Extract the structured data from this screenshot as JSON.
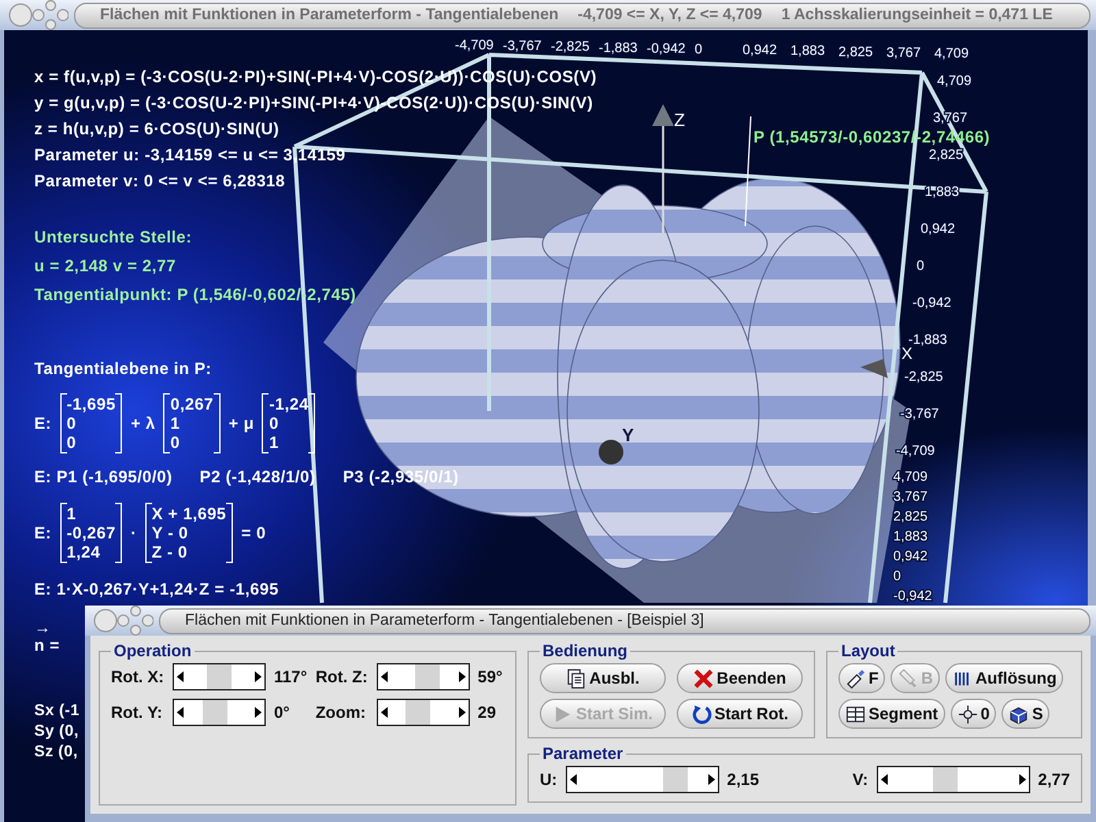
{
  "window": {
    "title": "Flächen mit Funktionen in Parameterform - Tangentialebenen",
    "range": "-4,709 <= X, Y, Z <= 4,709",
    "scale": "1 Achsskalierungseinheit = 0,471 LE"
  },
  "formulas": [
    "x = f(u,v,p) = (-3·COS(U-2·PI)+SIN(-PI+4·V)-COS(2·U))·COS(U)·COS(V)",
    "y = g(u,v,p) = (-3·COS(U-2·PI)+SIN(-PI+4·V)-COS(2·U))·COS(U)·SIN(V)",
    "z = h(u,v,p) = 6·COS(U)·SIN(U)",
    "Parameter u: -3,14159 <= u <= 3,14159",
    "Parameter v: 0 <= v <= 6,28318"
  ],
  "point": {
    "heading": "Untersuchte Stelle:",
    "uv": "u = 2,148 v = 2,77",
    "tangent_point": "Tangentialpunkt: P (1,546/-0,602/-2,745)"
  },
  "plane": {
    "heading": "Tangentialebene in P:",
    "label": "E:",
    "vectors": [
      [
        "-1,695",
        "0",
        "0"
      ],
      [
        "0,267",
        "1",
        "0"
      ],
      [
        "-1,24",
        "0",
        "1"
      ]
    ],
    "operators": [
      "+ λ",
      "+ μ"
    ],
    "points": [
      "E: P1 (-1,695/0/0)",
      "P2 (-1,428/1/0)",
      "P3 (-2,935/0/1)"
    ],
    "normal_form": {
      "label": "E:",
      "normal": [
        "1",
        "-0,267",
        "1,24"
      ],
      "dot": "·",
      "position": [
        "X + 1,695",
        "Y - 0",
        "Z - 0"
      ],
      "rhs": "= 0"
    },
    "coordinate_form": "E: 1·X-0,267·Y+1,24·Z = -1,695"
  },
  "normal_vector": {
    "arrow": "→",
    "label": "n ="
  },
  "intercepts": [
    "Sx (-1",
    "Sy (0,",
    "Sz (0,"
  ],
  "plot": {
    "x_ticks": [
      "-4,709",
      "-3,767",
      "-2,825",
      "-1,883",
      "-0,942",
      "0",
      "0,942",
      "1,883",
      "2,825",
      "3,767",
      "4,709"
    ],
    "z_ticks": [
      "4,709",
      "3,767",
      "2,825",
      "1,883",
      "0,942",
      "0",
      "-0,942",
      "-1,883",
      "-2,825",
      "-3,767",
      "-4,709"
    ],
    "y_ticks": [
      "4,709",
      "3,767",
      "2,825",
      "1,883",
      "0,942",
      "0",
      "-0,942"
    ],
    "z_label": "Z",
    "x_label": "X",
    "y_label": "Y",
    "point_label": "P (1,54573/-0,60237/-2,74466)"
  },
  "dialog": {
    "title": "Flächen mit Funktionen in Parameterform - Tangentialebenen - [Beispiel 3]",
    "operation": {
      "title": "Operation",
      "sliders": [
        {
          "label": "Rot. X:",
          "level": 0.5,
          "value": "117°"
        },
        {
          "label": "Rot. Z:",
          "level": 0.55,
          "value": "59°"
        },
        {
          "label": "Rot. Y:",
          "level": 0.45,
          "value": "0°"
        },
        {
          "label": "Zoom:",
          "level": 0.45,
          "value": "29"
        }
      ]
    },
    "control": {
      "title": "Bedienung",
      "buttons": [
        {
          "label": "Ausbl.",
          "kind": "document",
          "disabled": false
        },
        {
          "label": "Beenden",
          "kind": "cross",
          "disabled": false
        },
        {
          "label": "Start Sim.",
          "kind": "play",
          "disabled": true
        },
        {
          "label": "Start Rot.",
          "kind": "rotate",
          "disabled": false
        }
      ]
    },
    "layout": {
      "title": "Layout",
      "buttons": [
        {
          "label": "F",
          "kind": "brush",
          "disabled": false
        },
        {
          "label": "B",
          "kind": "flashlight",
          "disabled": true
        },
        {
          "label": "Auflösung",
          "kind": "bars",
          "disabled": false
        },
        {
          "label": "Segment",
          "kind": "grid",
          "disabled": false
        },
        {
          "label": "0",
          "kind": "crosshair",
          "disabled": false
        },
        {
          "label": "S",
          "kind": "cube",
          "disabled": false
        }
      ]
    },
    "parameter": {
      "title": "Parameter",
      "sliders": [
        {
          "label": "U:",
          "level": 0.72,
          "value": "2,15"
        },
        {
          "label": "V:",
          "level": 0.45,
          "value": "2,77"
        }
      ]
    }
  }
}
